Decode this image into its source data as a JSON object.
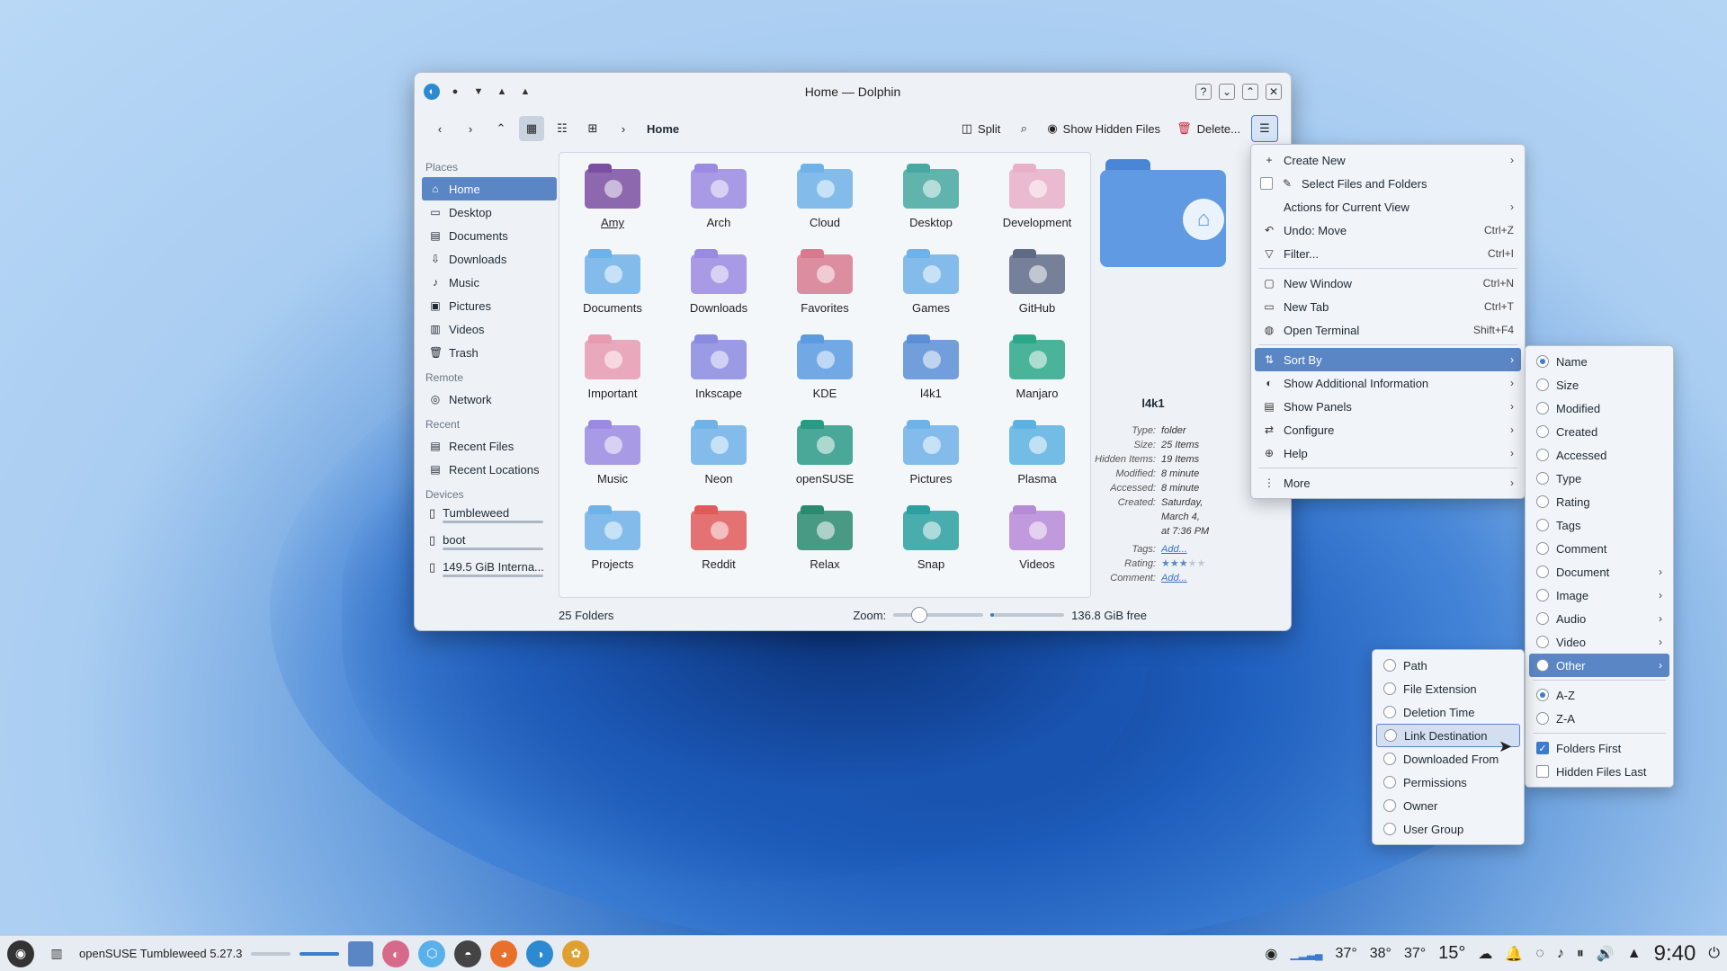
{
  "window": {
    "title": "Home — Dolphin",
    "toolbar": {
      "split": "Split",
      "show_hidden": "Show Hidden Files",
      "delete": "Delete...",
      "breadcrumb": "Home"
    }
  },
  "sidebar": {
    "places_head": "Places",
    "places": [
      {
        "label": "Home",
        "icon": "home-icon"
      },
      {
        "label": "Desktop",
        "icon": "desktop-icon"
      },
      {
        "label": "Documents",
        "icon": "documents-icon"
      },
      {
        "label": "Downloads",
        "icon": "downloads-icon"
      },
      {
        "label": "Music",
        "icon": "music-icon"
      },
      {
        "label": "Pictures",
        "icon": "pictures-icon"
      },
      {
        "label": "Videos",
        "icon": "videos-icon"
      },
      {
        "label": "Trash",
        "icon": "trash-icon"
      }
    ],
    "remote_head": "Remote",
    "remote": [
      {
        "label": "Network"
      }
    ],
    "recent_head": "Recent",
    "recent": [
      {
        "label": "Recent Files"
      },
      {
        "label": "Recent Locations"
      }
    ],
    "devices_head": "Devices",
    "devices": [
      {
        "label": "Tumbleweed"
      },
      {
        "label": "boot"
      },
      {
        "label": "149.5 GiB Interna..."
      }
    ]
  },
  "folders": [
    {
      "name": "Amy",
      "color": "#7a4fa0"
    },
    {
      "name": "Arch",
      "color": "#9a8ae0"
    },
    {
      "name": "Cloud",
      "color": "#6eb2e8"
    },
    {
      "name": "Desktop",
      "color": "#46a89f"
    },
    {
      "name": "Development",
      "color": "#e8b0c8"
    },
    {
      "name": "Documents",
      "color": "#6eb2e8"
    },
    {
      "name": "Downloads",
      "color": "#9a8ae0"
    },
    {
      "name": "Favorites",
      "color": "#d77a8e"
    },
    {
      "name": "Games",
      "color": "#6eb2e8"
    },
    {
      "name": "GitHub",
      "color": "#5f6b86"
    },
    {
      "name": "Important",
      "color": "#e89ab0"
    },
    {
      "name": "Inkscape",
      "color": "#8a8ae0"
    },
    {
      "name": "KDE",
      "color": "#5b9be0"
    },
    {
      "name": "l4k1",
      "color": "#5b8fd6"
    },
    {
      "name": "Manjaro",
      "color": "#2aa888"
    },
    {
      "name": "Music",
      "color": "#9a8ae0"
    },
    {
      "name": "Neon",
      "color": "#6eb2e8"
    },
    {
      "name": "openSUSE",
      "color": "#2a9a86"
    },
    {
      "name": "Pictures",
      "color": "#6eb2e8"
    },
    {
      "name": "Plasma",
      "color": "#5bb2e0"
    },
    {
      "name": "Projects",
      "color": "#6eb2e8"
    },
    {
      "name": "Reddit",
      "color": "#e05a5a"
    },
    {
      "name": "Relax",
      "color": "#2a8a70"
    },
    {
      "name": "Snap",
      "color": "#2aa0a0"
    },
    {
      "name": "Videos",
      "color": "#b68ad6"
    }
  ],
  "info_panel": {
    "name": "l4k1",
    "rows": [
      {
        "k": "Type:",
        "v": "folder"
      },
      {
        "k": "Size:",
        "v": "25 Items"
      },
      {
        "k": "Hidden Items:",
        "v": "19 Items"
      },
      {
        "k": "Modified:",
        "v": "8 minute"
      },
      {
        "k": "Accessed:",
        "v": "8 minute"
      },
      {
        "k": "Created:",
        "v": "Saturday,"
      },
      {
        "k": "",
        "v": "March 4, "
      },
      {
        "k": "",
        "v": "at 7:36 PM"
      }
    ],
    "tags_k": "Tags:",
    "tags_v": "Add...",
    "rating_k": "Rating:",
    "rating_value": 3,
    "comment_k": "Comment:",
    "comment_v": "Add..."
  },
  "status": {
    "count": "25 Folders",
    "zoom_label": "Zoom:",
    "zoom_level": 0.2,
    "free": "136.8 GiB free"
  },
  "main_menu": [
    {
      "label": "Create New",
      "icon": "plus-icon",
      "sub": true
    },
    {
      "label": "Select Files and Folders",
      "icon": "select-icon",
      "check": true
    },
    {
      "label": "Actions for Current View",
      "icon": "",
      "sub": true
    },
    {
      "label": "Undo: Move",
      "icon": "undo-icon",
      "sc": "Ctrl+Z"
    },
    {
      "label": "Filter...",
      "icon": "filter-icon",
      "sc": "Ctrl+I"
    },
    {
      "sep": true
    },
    {
      "label": "New Window",
      "icon": "window-icon",
      "sc": "Ctrl+N"
    },
    {
      "label": "New Tab",
      "icon": "tab-icon",
      "sc": "Ctrl+T"
    },
    {
      "label": "Open Terminal",
      "icon": "terminal-icon",
      "sc": "Shift+F4"
    },
    {
      "sep": true
    },
    {
      "label": "Sort By",
      "icon": "sort-icon",
      "sub": true,
      "hl": true
    },
    {
      "label": "Show Additional Information",
      "icon": "info-icon",
      "sub": true
    },
    {
      "label": "Show Panels",
      "icon": "panels-icon",
      "sub": true
    },
    {
      "label": "Configure",
      "icon": "configure-icon",
      "sub": true
    },
    {
      "label": "Help",
      "icon": "help-icon",
      "sub": true
    },
    {
      "sep": true
    },
    {
      "label": "More",
      "icon": "more-icon",
      "sub": true
    }
  ],
  "sort_menu": [
    {
      "label": "Name",
      "radio": true,
      "on": true
    },
    {
      "label": "Size",
      "radio": true
    },
    {
      "label": "Modified",
      "radio": true
    },
    {
      "label": "Created",
      "radio": true
    },
    {
      "label": "Accessed",
      "radio": true
    },
    {
      "label": "Type",
      "radio": true
    },
    {
      "label": "Rating",
      "radio": true
    },
    {
      "label": "Tags",
      "radio": true
    },
    {
      "label": "Comment",
      "radio": true
    },
    {
      "label": "Document",
      "sub": true
    },
    {
      "label": "Image",
      "sub": true
    },
    {
      "label": "Audio",
      "sub": true
    },
    {
      "label": "Video",
      "sub": true
    },
    {
      "label": "Other",
      "sub": true,
      "hl": true
    },
    {
      "sep": true
    },
    {
      "label": "A-Z",
      "radio": true,
      "on": true
    },
    {
      "label": "Z-A",
      "radio": true
    },
    {
      "sep": true
    },
    {
      "label": "Folders First",
      "check": true,
      "on": true
    },
    {
      "label": "Hidden Files Last",
      "check": true
    }
  ],
  "other_menu": [
    {
      "label": "Path"
    },
    {
      "label": "File Extension"
    },
    {
      "label": "Deletion Time"
    },
    {
      "label": "Link Destination",
      "hover": true
    },
    {
      "label": "Downloaded From"
    },
    {
      "label": "Permissions"
    },
    {
      "label": "Owner"
    },
    {
      "label": "User Group"
    }
  ],
  "taskbar": {
    "task_title": "openSUSE Tumbleweed 5.27.3",
    "temps": [
      "37°",
      "38°",
      "37°"
    ],
    "weather": "15°",
    "clock": "9:40"
  },
  "colors": {
    "accent": "#3d7bd0",
    "selection": "#5b86c6"
  }
}
